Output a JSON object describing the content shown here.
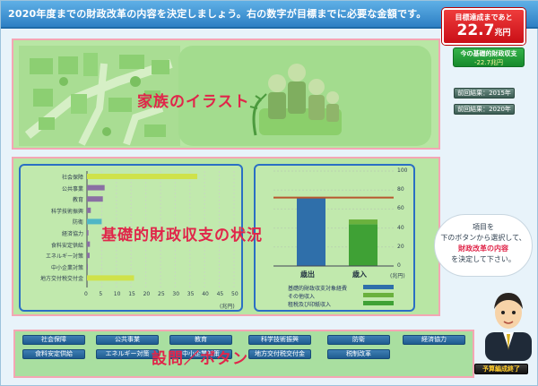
{
  "header": {
    "instruction": "2020年度までの財政改革の内容を決定しましょう。右の数字が目標までに必要な金額です。"
  },
  "goal": {
    "title": "目標達成まであと",
    "value": "22.7",
    "unit": "兆円"
  },
  "current_balance": {
    "title": "今の基礎的財政収支",
    "value": "-22.7兆円"
  },
  "previous_results": [
    "前回結果：2015年",
    "前回結果：2020年"
  ],
  "illustration_panel": {
    "label": "家族のイラスト"
  },
  "status_panel": {
    "label": "基礎的財政収支の状況"
  },
  "question_panel": {
    "label": "設問／ボタン"
  },
  "bar_chart": {
    "categories": [
      "社会保障",
      "公共事業",
      "教育",
      "科学技術振興",
      "防衛",
      "経済協力",
      "食料安定供給",
      "エネルギー対策",
      "中小企業対策",
      "地方交付税交付金"
    ],
    "tick_labels": [
      "0",
      "5",
      "10",
      "15",
      "20",
      "25",
      "30",
      "35",
      "40",
      "45",
      "50"
    ],
    "unit": "(兆円)"
  },
  "column_chart": {
    "tick_labels": [
      "0",
      "20",
      "40",
      "60",
      "80",
      "100"
    ],
    "unit": "(兆円)",
    "x_labels": [
      "歳出",
      "歳入"
    ],
    "legend": [
      "基礎的財政収支対象経費",
      "その他収入",
      "租税及び印紙収入"
    ]
  },
  "chart_data": [
    {
      "type": "bar",
      "orientation": "horizontal",
      "categories": [
        "社会保障",
        "公共事業",
        "教育",
        "科学技術振興",
        "防衛",
        "経済協力",
        "食料安定供給",
        "エネルギー対策",
        "中小企業対策",
        "地方交付税交付金"
      ],
      "values": [
        37.5,
        6.0,
        5.4,
        1.3,
        5.0,
        0.5,
        1.0,
        0.9,
        0.2,
        16.0
      ],
      "xlabel": "(兆円)",
      "xlim": [
        0,
        50
      ],
      "colors": [
        "#cfe24a",
        "#8a6fa3",
        "#8a6fa3",
        "#8a6fa3",
        "#4fb6c6",
        "#8a6fa3",
        "#8a6fa3",
        "#8a6fa3",
        "#8a6fa3",
        "#cfe24a"
      ]
    },
    {
      "type": "bar",
      "orientation": "vertical-stacked",
      "categories": [
        "歳出",
        "歳入"
      ],
      "series": [
        {
          "name": "基礎的財政収支対象経費",
          "values": [
            72,
            0
          ],
          "color": "#2f6faa"
        },
        {
          "name": "その他収入",
          "values": [
            0,
            5
          ],
          "color": "#6ab13d"
        },
        {
          "name": "租税及び印紙収入",
          "values": [
            0,
            44
          ],
          "color": "#3fa135"
        }
      ],
      "reference_line": 72,
      "ylabel": "(兆円)",
      "ylim": [
        0,
        100
      ]
    }
  ],
  "buttons": [
    "社会保障",
    "公共事業",
    "教育",
    "科学技術振興",
    "防衛",
    "経済協力",
    "食料安定供給",
    "エネルギー対策",
    "中小企業対策",
    "地方交付税交付金",
    "税制改革"
  ],
  "speech_bubble": {
    "line1": "項目を",
    "line2": "下のボタンから選択して、",
    "line3": "財政改革の内容",
    "line4": "を決定して下さい。"
  },
  "finish_button": "予算編成終了",
  "colors": {
    "accent_pink": "#e0264a",
    "header_blue": "#2d7fc4",
    "goal_red": "#c90f16",
    "panel_green": "#b8e6a4"
  }
}
